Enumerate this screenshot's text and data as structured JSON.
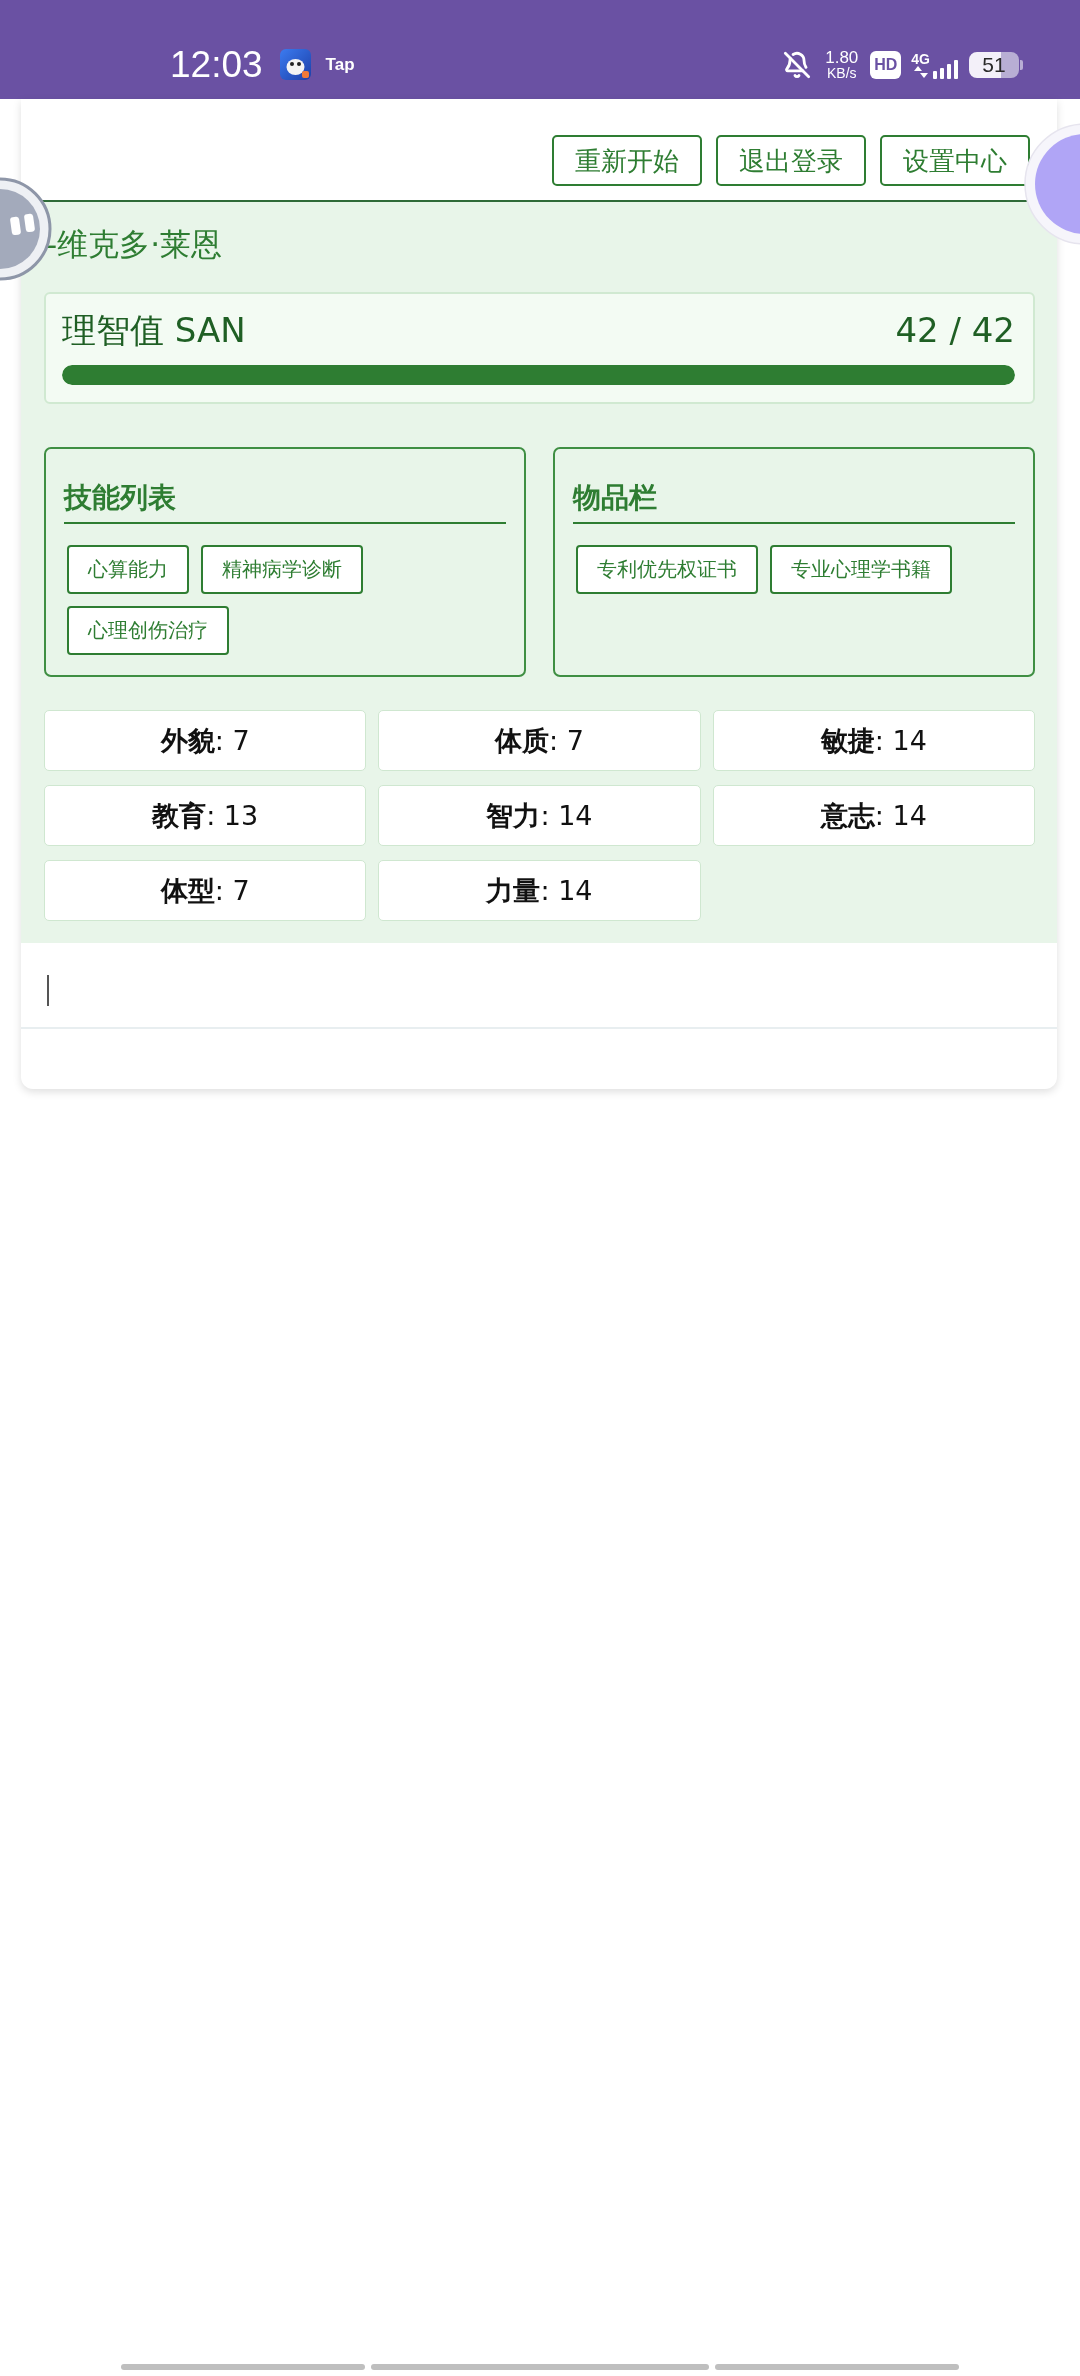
{
  "status_bar": {
    "time": "12:03",
    "app_label": "Tap",
    "speed_value": "1.80",
    "speed_unit": "KB/s",
    "hd_badge": "HD",
    "network_type": "4G",
    "battery": "51"
  },
  "toolbar": {
    "buttons": [
      "重新开始",
      "退出登录",
      "设置中心"
    ]
  },
  "character": {
    "name": "-维克多·莱恩",
    "sanity": {
      "label": "理智值 SAN",
      "reading": "42 / 42",
      "level": 1
    },
    "panels": [
      {
        "title": "技能列表",
        "tags": [
          "心算能力",
          "精神病学诊断",
          "心理创伤治疗"
        ]
      },
      {
        "title": "物品栏",
        "tags": [
          "专利优先权证书",
          "专业心理学书籍"
        ]
      }
    ],
    "attributes": [
      "**外貌**: 7",
      "**体质**: 7",
      "**敏捷**: 14",
      "**教育**: 13",
      "**智力**: 14",
      "**意志**: 14",
      "**体型**: 7",
      "**力量**: 14"
    ]
  },
  "message_input": {
    "focused": true
  }
}
